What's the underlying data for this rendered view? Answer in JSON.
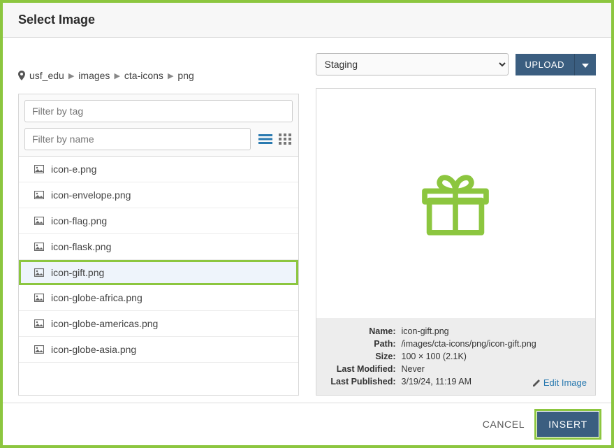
{
  "colors": {
    "accent": "#8cc63f",
    "primary": "#3b5e80"
  },
  "header": {
    "title": "Select Image"
  },
  "breadcrumb": [
    "usf_edu",
    "images",
    "cta-icons",
    "png"
  ],
  "filters": {
    "tag_placeholder": "Filter by tag",
    "name_placeholder": "Filter by name"
  },
  "view": {
    "mode": "list"
  },
  "files": [
    {
      "name": "icon-e.png",
      "selected": false
    },
    {
      "name": "icon-envelope.png",
      "selected": false
    },
    {
      "name": "icon-flag.png",
      "selected": false
    },
    {
      "name": "icon-flask.png",
      "selected": false
    },
    {
      "name": "icon-gift.png",
      "selected": true
    },
    {
      "name": "icon-globe-africa.png",
      "selected": false
    },
    {
      "name": "icon-globe-americas.png",
      "selected": false
    },
    {
      "name": "icon-globe-asia.png",
      "selected": false
    }
  ],
  "environment": {
    "selected": "Staging",
    "upload_label": "UPLOAD"
  },
  "preview": {
    "icon": "gift-icon",
    "meta": {
      "name_label": "Name:",
      "name": "icon-gift.png",
      "path_label": "Path:",
      "path": "/images/cta-icons/png/icon-gift.png",
      "size_label": "Size:",
      "size": "100 × 100 (2.1K)",
      "modified_label": "Last Modified:",
      "modified": "Never",
      "published_label": "Last Published:",
      "published": "3/19/24, 11:19 AM"
    },
    "edit_label": "Edit Image"
  },
  "footer": {
    "cancel": "CANCEL",
    "insert": "INSERT"
  }
}
